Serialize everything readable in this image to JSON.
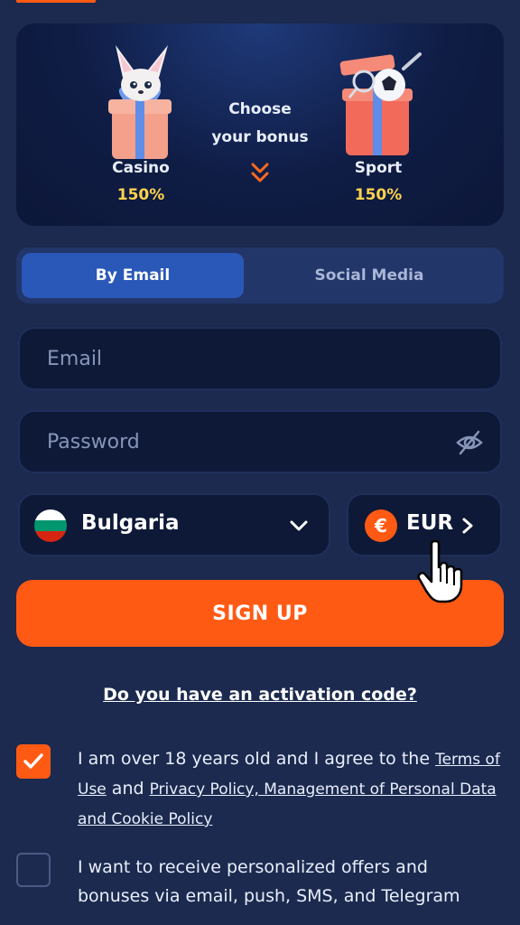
{
  "bonus": {
    "casino": {
      "name": "Casino",
      "percent": "150%"
    },
    "choose_line1": "Choose",
    "choose_line2": "your bonus",
    "sport": {
      "name": "Sport",
      "percent": "150%"
    }
  },
  "tabs": [
    {
      "label": "By Email",
      "active": true
    },
    {
      "label": "Social Media",
      "active": false
    }
  ],
  "form": {
    "email_placeholder": "Email",
    "password_placeholder": "Password",
    "country": "Bulgaria",
    "currency": "EUR",
    "currency_symbol": "€",
    "signup_label": "SIGN UP"
  },
  "activation_link": "Do you have an activation code?",
  "terms": {
    "checked": true,
    "text_before": "I am over 18 years old and I agree to the ",
    "link_terms": "Terms of Use",
    "text_and": " and ",
    "link_privacy": "Privacy Policy, Management of Personal Data and Cookie Policy"
  },
  "offers": {
    "checked": false,
    "text": "I want to receive personalized offers and bonuses via email, push, SMS, and Telegram"
  },
  "colors": {
    "background": "#1b2a4e",
    "accent": "#ff5a14",
    "tab_active": "#2a58b8",
    "percent": "#ffd34d"
  },
  "icons": [
    "gift-fox-icon",
    "gift-ball-icon",
    "double-chevron-down-icon",
    "eye-off-icon",
    "bulgaria-flag-icon",
    "chevron-down-icon",
    "euro-icon",
    "chevron-right-icon",
    "check-icon",
    "hand-cursor-icon"
  ]
}
